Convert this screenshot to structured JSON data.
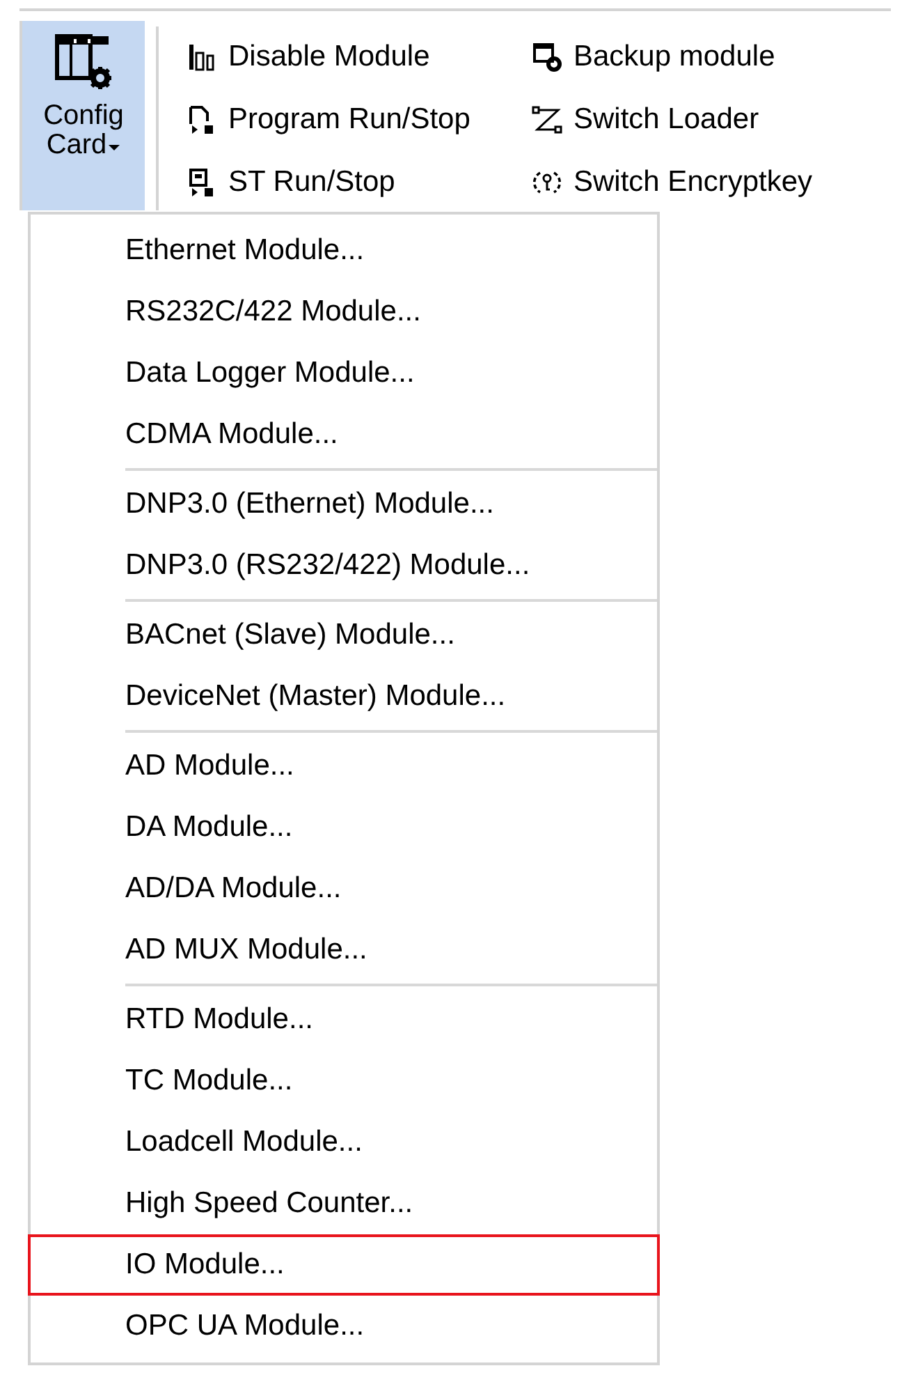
{
  "config_button": {
    "label_lines": [
      "Config",
      "Card"
    ],
    "pressed": true
  },
  "commands": [
    {
      "label": "Disable Module"
    },
    {
      "label": "Program Run/Stop"
    },
    {
      "label": "ST Run/Stop"
    },
    {
      "label": "Backup module"
    },
    {
      "label": "Switch Loader"
    },
    {
      "label": "Switch Encryptkey"
    }
  ],
  "menu": {
    "groups": [
      [
        {
          "label": "Ethernet Module...",
          "selected": false
        },
        {
          "label": "RS232C/422 Module...",
          "selected": false
        },
        {
          "label": "Data Logger Module...",
          "selected": false
        },
        {
          "label": "CDMA Module...",
          "selected": false
        }
      ],
      [
        {
          "label": "DNP3.0 (Ethernet) Module...",
          "selected": false
        },
        {
          "label": "DNP3.0 (RS232/422) Module...",
          "selected": false
        }
      ],
      [
        {
          "label": "BACnet (Slave) Module...",
          "selected": false
        },
        {
          "label": "DeviceNet (Master) Module...",
          "selected": false
        }
      ],
      [
        {
          "label": "AD Module...",
          "selected": false
        },
        {
          "label": "DA Module...",
          "selected": false
        },
        {
          "label": "AD/DA Module...",
          "selected": false
        },
        {
          "label": "AD MUX Module...",
          "selected": false
        }
      ],
      [
        {
          "label": "RTD Module...",
          "selected": false
        },
        {
          "label": "TC Module...",
          "selected": false
        },
        {
          "label": "Loadcell Module...",
          "selected": false
        },
        {
          "label": "High Speed Counter...",
          "selected": false
        },
        {
          "label": "IO Module...",
          "selected": true
        },
        {
          "label": "OPC UA Module...",
          "selected": false
        }
      ]
    ]
  }
}
